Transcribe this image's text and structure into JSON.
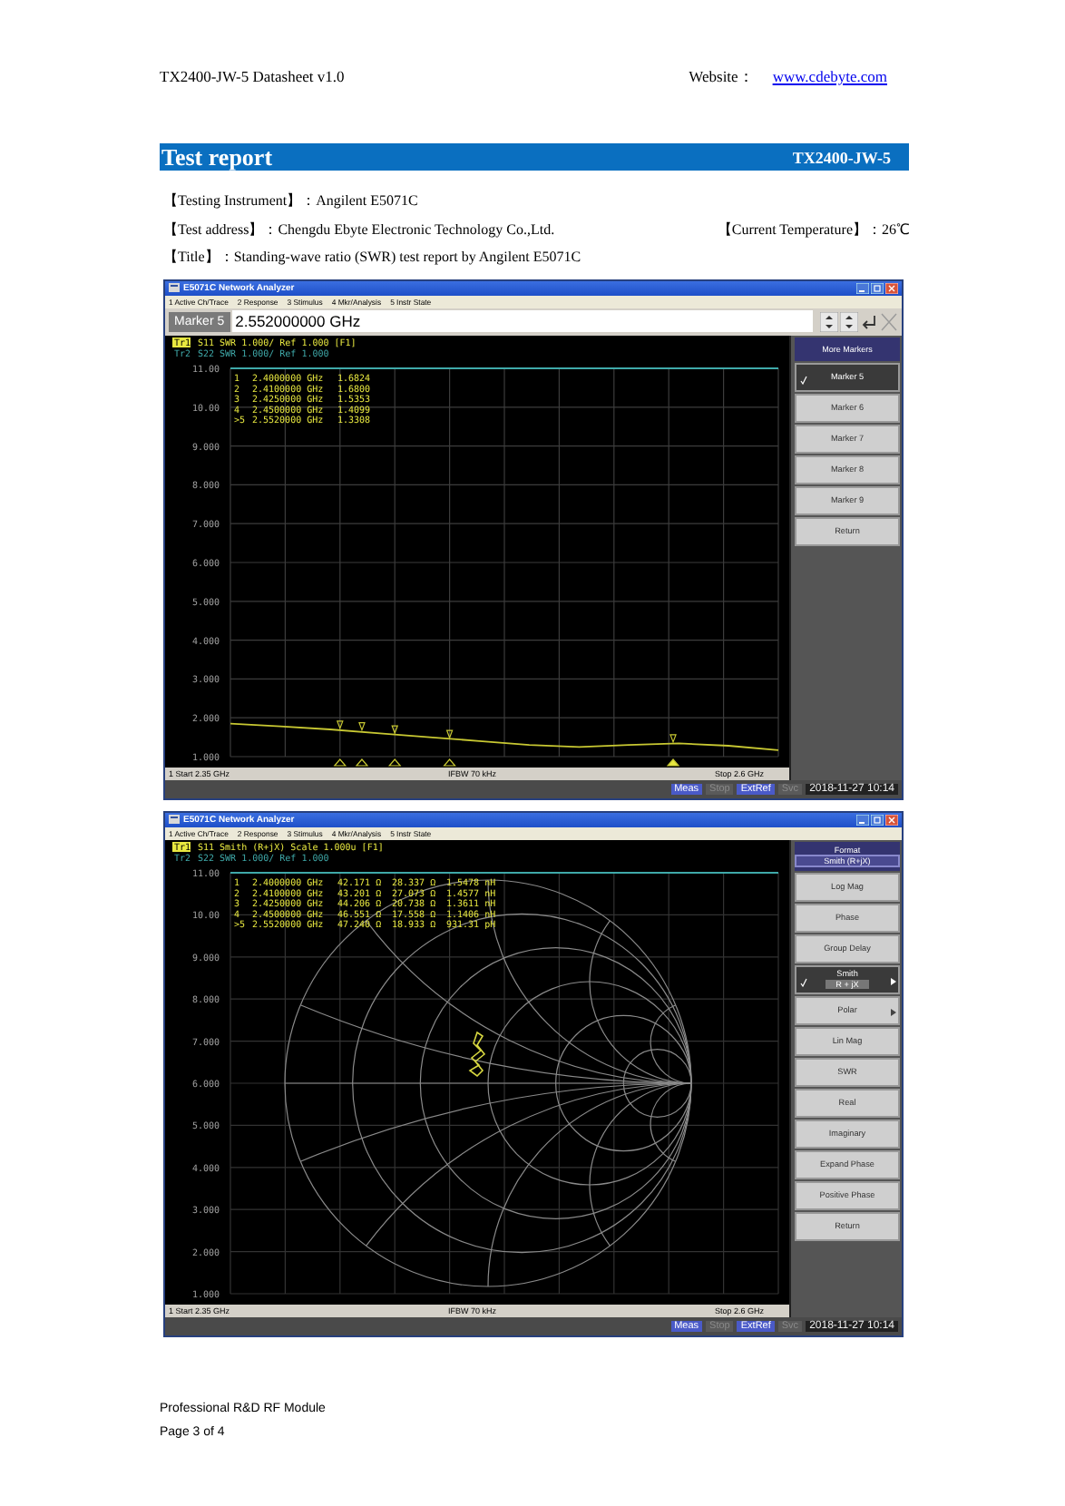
{
  "header": {
    "doc_title": "TX2400-JW-5 Datasheet v1.0",
    "website_label": "Website：",
    "website_link": "www.cdebyte.com"
  },
  "banner": {
    "title": "Test report",
    "model": "TX2400-JW-5"
  },
  "info_lines": [
    [
      "【Testing Instrument】：Angilent E5071C"
    ],
    [
      "【Test address】：Chengdu Ebyte Electronic Technology Co.,Ltd.",
      "【Current Temperature】：26℃"
    ],
    [
      "【Title】：Standing-wave ratio (SWR) test report by Angilent E5071C"
    ]
  ],
  "screens": [
    {
      "window_title": "E5071C Network Analyzer",
      "menu": [
        "1 Active Ch/Trace",
        "2 Response",
        "3 Stimulus",
        "4 Mkr/Analysis",
        "5 Instr State"
      ],
      "marker_entry": {
        "label": "Marker 5",
        "value": "2.552000000 GHz"
      },
      "trace_lines": [
        {
          "badge": "Tr1",
          "text": "S11 SWR 1.000/ Ref 1.000 [F1]",
          "active": true
        },
        {
          "badge": "Tr2",
          "text": "S22 SWR 1.000/ Ref 1.000",
          "active": false
        }
      ],
      "marker_table": [
        [
          "1",
          "2.4000000 GHz",
          "1.6824"
        ],
        [
          "2",
          "2.4100000 GHz",
          "1.6800"
        ],
        [
          "3",
          "2.4250000 GHz",
          "1.5353"
        ],
        [
          "4",
          "2.4500000 GHz",
          "1.4099"
        ],
        [
          ">5",
          "2.5520000 GHz",
          "1.3308"
        ]
      ],
      "plot": {
        "kind": "cartesian",
        "chart_data": {
          "type": "line",
          "categories": [
            null,
            null,
            null,
            null,
            null,
            null,
            null,
            null,
            null,
            null,
            null,
            null
          ],
          "series": [
            {
              "color": "#c8c832",
              "values": [
                1.85,
                1.78,
                1.7,
                1.6,
                1.5,
                1.4,
                1.3,
                1.25,
                1.3,
                1.34,
                1.28,
                1.17
              ]
            },
            {
              "color": "#3fa9a9",
              "values": [
                11,
                11,
                11,
                11,
                11,
                11,
                11,
                11,
                11,
                11,
                11,
                11
              ]
            }
          ],
          "ylim": [
            1,
            11
          ],
          "grid": true,
          "yticks": [
            {
              "value": 11,
              "label": "11.00"
            },
            {
              "value": 10,
              "label": "10.00"
            },
            {
              "value": 9,
              "label": "9.000"
            },
            {
              "value": 8,
              "label": "8.000"
            },
            {
              "value": 7,
              "label": "7.000"
            },
            {
              "value": 6,
              "label": "6.000"
            },
            {
              "value": 5,
              "label": "5.000"
            },
            {
              "value": 4,
              "label": "4.000"
            },
            {
              "value": 3,
              "label": "3.000"
            },
            {
              "value": 2,
              "label": "2.000"
            },
            {
              "value": 1,
              "label": "1.000"
            }
          ]
        }
      },
      "status": {
        "start": "1 Start 2.35 GHz",
        "ifbw": "IFBW 70 kHz",
        "stop": "Stop 2.6 GHz"
      },
      "indicators": [
        {
          "label": "Meas",
          "on": true
        },
        {
          "label": "Stop",
          "on": false
        },
        {
          "label": "ExtRef",
          "on": true
        },
        {
          "label": "Svc",
          "on": false
        }
      ],
      "datetime": "2018-11-27 10:14",
      "softkeys": {
        "header": "More Markers",
        "keys": [
          {
            "label": "Marker 5",
            "selected": true
          },
          {
            "label": "Marker 6",
            "selected": false
          },
          {
            "label": "Marker 7",
            "selected": false
          },
          {
            "label": "Marker 8",
            "selected": false
          },
          {
            "label": "Marker 9",
            "selected": false
          },
          {
            "label": "Return",
            "selected": false
          }
        ]
      }
    },
    {
      "window_title": "E5071C Network Analyzer",
      "menu": [
        "1 Active Ch/Trace",
        "2 Response",
        "3 Stimulus",
        "4 Mkr/Analysis",
        "5 Instr State"
      ],
      "trace_lines": [
        {
          "badge": "Tr1",
          "text": "S11 Smith (R+jX) Scale 1.000u [F1]",
          "active": true
        },
        {
          "badge": "Tr2",
          "text": "S22 SWR 1.000/ Ref 1.000",
          "active": false
        }
      ],
      "marker_table": [
        [
          "1",
          "2.4000000 GHz",
          "42.171 Ω",
          "28.337 Ω",
          "1.5478 nH"
        ],
        [
          "2",
          "2.4100000 GHz",
          "43.201 Ω",
          "27.073 Ω",
          "1.4577 nH"
        ],
        [
          "3",
          "2.4250000 GHz",
          "44.206 Ω",
          "20.738 Ω",
          "1.3611 nH"
        ],
        [
          "4",
          "2.4500000 GHz",
          "46.551 Ω",
          "17.558 Ω",
          "1.1406 nH"
        ],
        [
          ">5",
          "2.5520000 GHz",
          "47.240 Ω",
          "18.933 Ω",
          "931.31 pH"
        ]
      ],
      "plot": {
        "kind": "smith",
        "y_labels": [
          "11.00",
          "10.00",
          "9.000",
          "8.000",
          "7.000",
          "6.000",
          "5.000",
          "4.000",
          "3.000",
          "2.000",
          "1.000"
        ]
      },
      "status": {
        "start": "1 Start 2.35 GHz",
        "ifbw": "IFBW 70 kHz",
        "stop": "Stop 2.6 GHz"
      },
      "indicators": [
        {
          "label": "Meas",
          "on": true
        },
        {
          "label": "Stop",
          "on": false
        },
        {
          "label": "ExtRef",
          "on": true
        },
        {
          "label": "Svc",
          "on": false
        }
      ],
      "datetime": "2018-11-27 10:14",
      "softkeys": {
        "header": "Format",
        "header_value": "Smith (R+jX)",
        "keys": [
          {
            "label": "Log Mag",
            "selected": false
          },
          {
            "label": "Phase",
            "selected": false
          },
          {
            "label": "Group Delay",
            "selected": false
          },
          {
            "label": "Smith",
            "sublabel": "R + jX",
            "selected": true,
            "submenu": true
          },
          {
            "label": "Polar",
            "selected": false,
            "submenu": true
          },
          {
            "label": "Lin Mag",
            "selected": false
          },
          {
            "label": "SWR",
            "selected": false
          },
          {
            "label": "Real",
            "selected": false
          },
          {
            "label": "Imaginary",
            "selected": false
          },
          {
            "label": "Expand Phase",
            "selected": false
          },
          {
            "label": "Positive Phase",
            "selected": false
          },
          {
            "label": "Return",
            "selected": false
          }
        ]
      }
    }
  ],
  "footer": [
    "Professional R&D RF Module",
    "Page 3 of 4"
  ]
}
